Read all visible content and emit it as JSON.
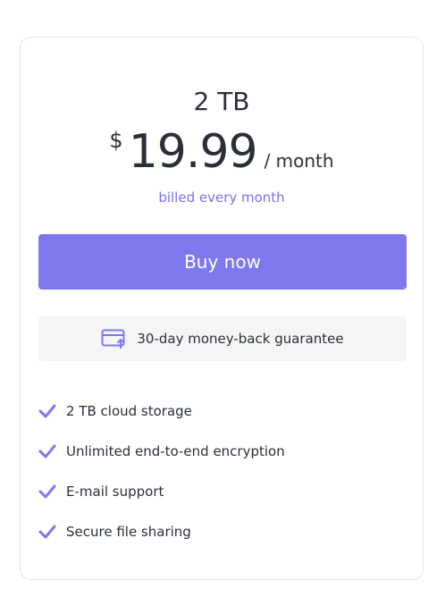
{
  "plan": {
    "name": "2 TB",
    "currency": "$",
    "amount": "19.99",
    "period": "/ month",
    "billing": "billed every month"
  },
  "actions": {
    "buy_label": "Buy now"
  },
  "guarantee": {
    "label": "30-day money-back guarantee",
    "icon": "card-refund-icon"
  },
  "features": [
    "2 TB cloud storage",
    "Unlimited end-to-end encryption",
    "E-mail support",
    "Secure file sharing"
  ],
  "colors": {
    "accent": "#7e78ee",
    "accent_text": "#7b72e8",
    "text": "#2b2f3a",
    "guarantee_bg": "#f5f5f6",
    "card_border": "#e6e6ea"
  }
}
